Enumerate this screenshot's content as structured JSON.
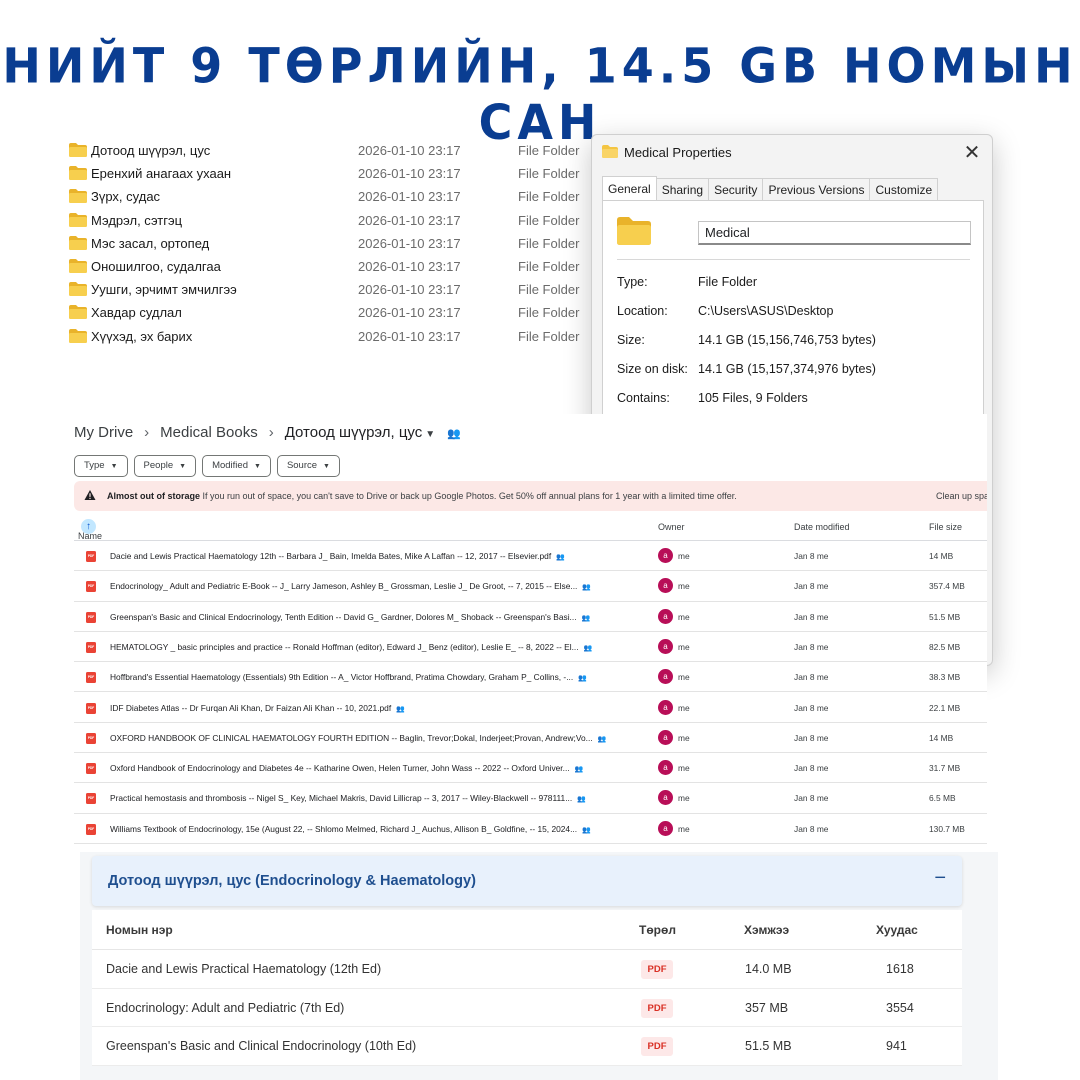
{
  "headline": "НИЙТ 9 ТӨРЛИЙН, 14.5 GB НОМЫН САН",
  "explorer": {
    "rows": [
      {
        "name": "Дотоод шүүрэл, цус",
        "date": "2026-01-10 23:17",
        "type": "File Folder"
      },
      {
        "name": "Еренхий анагаах ухаан",
        "date": "2026-01-10 23:17",
        "type": "File Folder"
      },
      {
        "name": "Зүрх, судас",
        "date": "2026-01-10 23:17",
        "type": "File Folder"
      },
      {
        "name": "Мэдрэл, сэтгэц",
        "date": "2026-01-10 23:17",
        "type": "File Folder"
      },
      {
        "name": "Мэс засал, ортопед",
        "date": "2026-01-10 23:17",
        "type": "File Folder"
      },
      {
        "name": "Оношилгоо, судалгаа",
        "date": "2026-01-10 23:17",
        "type": "File Folder"
      },
      {
        "name": "Уушги, эрчимт эмчилгээ",
        "date": "2026-01-10 23:17",
        "type": "File Folder"
      },
      {
        "name": "Хавдар судлал",
        "date": "2026-01-10 23:17",
        "type": "File Folder"
      },
      {
        "name": "Хүүхэд, эх барих",
        "date": "2026-01-10 23:17",
        "type": "File Folder"
      }
    ]
  },
  "properties": {
    "title": "Medical Properties",
    "close": "✕",
    "tabs": [
      "General",
      "Sharing",
      "Security",
      "Previous Versions",
      "Customize"
    ],
    "name_value": "Medical",
    "fields": [
      {
        "key": "Type:",
        "value": "File Folder"
      },
      {
        "key": "Location:",
        "value": "C:\\Users\\ASUS\\Desktop"
      },
      {
        "key": "Size:",
        "value": "14.1 GB (15,156,746,753 bytes)"
      },
      {
        "key": "Size on disk:",
        "value": "14.1 GB (15,157,374,976 bytes)"
      },
      {
        "key": "Contains:",
        "value": "105 Files, 9 Folders"
      }
    ]
  },
  "drive": {
    "breadcrumb": [
      "My Drive",
      "Medical Books",
      "Дотоод шүүрэл, цус"
    ],
    "breadcrumb_sep": "›",
    "filters": [
      "Type",
      "People",
      "Modified",
      "Source"
    ],
    "banner": {
      "bold": "Almost out of storage",
      "text": " If you run out of space, you can't save to Drive or back up Google Photos. Get 50% off annual plans for 1 year with a limited time offer.",
      "action": "Clean up spa"
    },
    "columns": {
      "name": "Name",
      "sort": "↑",
      "owner": "Owner",
      "modified": "Date modified",
      "size": "File size"
    },
    "file_icon_label": "PDF",
    "rows": [
      {
        "name": "Dacie and Lewis Practical Haematology 12th -- Barbara J_ Bain, Imelda Bates, Mike A Laffan -- 12, 2017 -- Elsevier.pdf",
        "avatar": "a",
        "owner": "me",
        "modified": "Jan 8 me",
        "size": "14 MB"
      },
      {
        "name": "Endocrinology_ Adult and Pediatric E-Book -- J_ Larry Jameson, Ashley B_ Grossman, Leslie J_ De Groot, -- 7, 2015 -- Else...",
        "avatar": "a",
        "owner": "me",
        "modified": "Jan 8 me",
        "size": "357.4 MB"
      },
      {
        "name": "Greenspan's Basic and Clinical Endocrinology, Tenth Edition -- David G_ Gardner, Dolores M_ Shoback -- Greenspan's Basi...",
        "avatar": "a",
        "owner": "me",
        "modified": "Jan 8 me",
        "size": "51.5 MB"
      },
      {
        "name": "HEMATOLOGY _ basic principles and practice -- Ronald Hoffman (editor), Edward J_ Benz (editor), Leslie E_ -- 8, 2022 -- El...",
        "avatar": "a",
        "owner": "me",
        "modified": "Jan 8 me",
        "size": "82.5 MB"
      },
      {
        "name": "Hoffbrand's Essential Haematology (Essentials) 9th Edition -- A_ Victor Hoffbrand, Pratima Chowdary, Graham P_ Collins, -...",
        "avatar": "a",
        "owner": "me",
        "modified": "Jan 8 me",
        "size": "38.3 MB"
      },
      {
        "name": "IDF Diabetes Atlas -- Dr Furqan Ali Khan, Dr Faizan Ali Khan -- 10, 2021.pdf",
        "avatar": "a",
        "owner": "me",
        "modified": "Jan 8 me",
        "size": "22.1 MB"
      },
      {
        "name": "OXFORD HANDBOOK OF CLINICAL HAEMATOLOGY  FOURTH EDITION -- Baglin, Trevor;Dokal, Inderjeet;Provan, Andrew;Vo...",
        "avatar": "a",
        "owner": "me",
        "modified": "Jan 8 me",
        "size": "14 MB"
      },
      {
        "name": "Oxford Handbook of Endocrinology and Diabetes 4e -- Katharine Owen, Helen Turner, John Wass -- 2022 -- Oxford Univer...",
        "avatar": "a",
        "owner": "me",
        "modified": "Jan 8 me",
        "size": "31.7 MB"
      },
      {
        "name": "Practical hemostasis and thrombosis -- Nigel S_ Key, Michael Makris, David Lillicrap -- 3, 2017 -- Wiley-Blackwell -- 978111...",
        "avatar": "a",
        "owner": "me",
        "modified": "Jan 8 me",
        "size": "6.5 MB"
      },
      {
        "name": "Williams Textbook of Endocrinology, 15e (August 22, -- Shlomo Melmed, Richard J_ Auchus, Allison B_ Goldfine, -- 15, 2024...",
        "avatar": "a",
        "owner": "me",
        "modified": "Jan 8 me",
        "size": "130.7 MB"
      }
    ]
  },
  "catalog": {
    "section_title": "Дотоод шүүрэл, цус (Endocrinology & Haematology)",
    "collapse": "−",
    "columns": {
      "name": "Номын нэр",
      "type": "Төрөл",
      "size": "Хэмжээ",
      "pages": "Хуудас"
    },
    "rows": [
      {
        "name": "Dacie and Lewis Practical Haematology (12th Ed)",
        "type": "PDF",
        "size": "14.0 MB",
        "pages": "1618"
      },
      {
        "name": "Endocrinology: Adult and Pediatric (7th Ed)",
        "type": "PDF",
        "size": "357 MB",
        "pages": "3554"
      },
      {
        "name": "Greenspan's Basic and Clinical Endocrinology (10th Ed)",
        "type": "PDF",
        "size": "51.5 MB",
        "pages": "941"
      }
    ]
  },
  "colors": {
    "headline": "#0a3d91",
    "folder": "#f4c542",
    "pdf_red": "#ea4335",
    "avatar": "#b80e57"
  }
}
